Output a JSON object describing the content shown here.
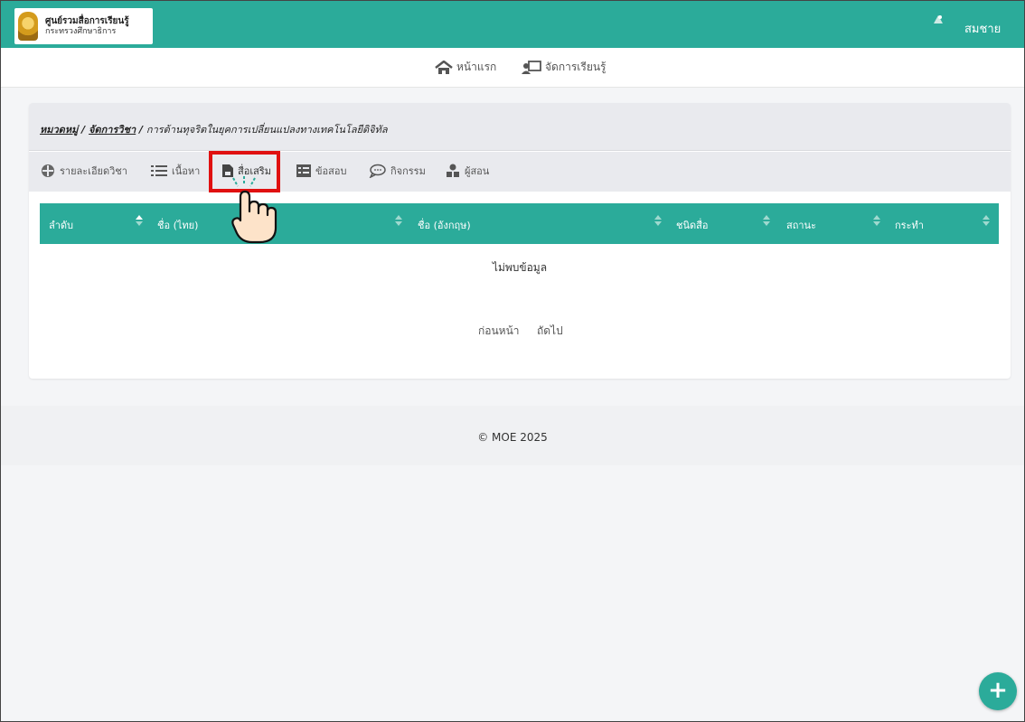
{
  "header": {
    "logo_title": "ศูนย์รวมสื่อการเรียนรู้",
    "logo_subtitle": "กระทรวงศึกษาธิการ",
    "user_name": "สมชาย"
  },
  "nav": {
    "home": "หน้าแรก",
    "manage": "จัดการเรียนรู้"
  },
  "breadcrumb": {
    "category": "หมวดหมู่",
    "subjects": "จัดการวิชา",
    "current": "การต้านทุจริตในยุคการเปลี่ยนแปลงทางเทคโนโลยีดิจิทัล",
    "sep": "/"
  },
  "tabs": [
    {
      "label": "รายละเอียดวิชา",
      "icon": "info-circle-icon"
    },
    {
      "label": "เนื้อหา",
      "icon": "list-icon"
    },
    {
      "label": "สื่อเสริม",
      "icon": "file-icon",
      "active": true
    },
    {
      "label": "ข้อสอบ",
      "icon": "table-list-icon"
    },
    {
      "label": "กิจกรรม",
      "icon": "chat-bubble-icon"
    },
    {
      "label": "ผู้สอน",
      "icon": "users-icon"
    }
  ],
  "table": {
    "columns": [
      "ลำดับ",
      "ชื่อ (ไทย)",
      "ชื่อ (อังกฤษ)",
      "ชนิดสื่อ",
      "สถานะ",
      "กระทำ"
    ],
    "empty_text": "ไม่พบข้อมูล"
  },
  "pager": {
    "prev": "ก่อนหน้า",
    "next": "ถัดไป"
  },
  "footer": {
    "copyright": "© MOE 2025"
  },
  "fab": {
    "label": "+"
  },
  "colors": {
    "brand": "#2bab9a",
    "highlight": "#e01010"
  }
}
